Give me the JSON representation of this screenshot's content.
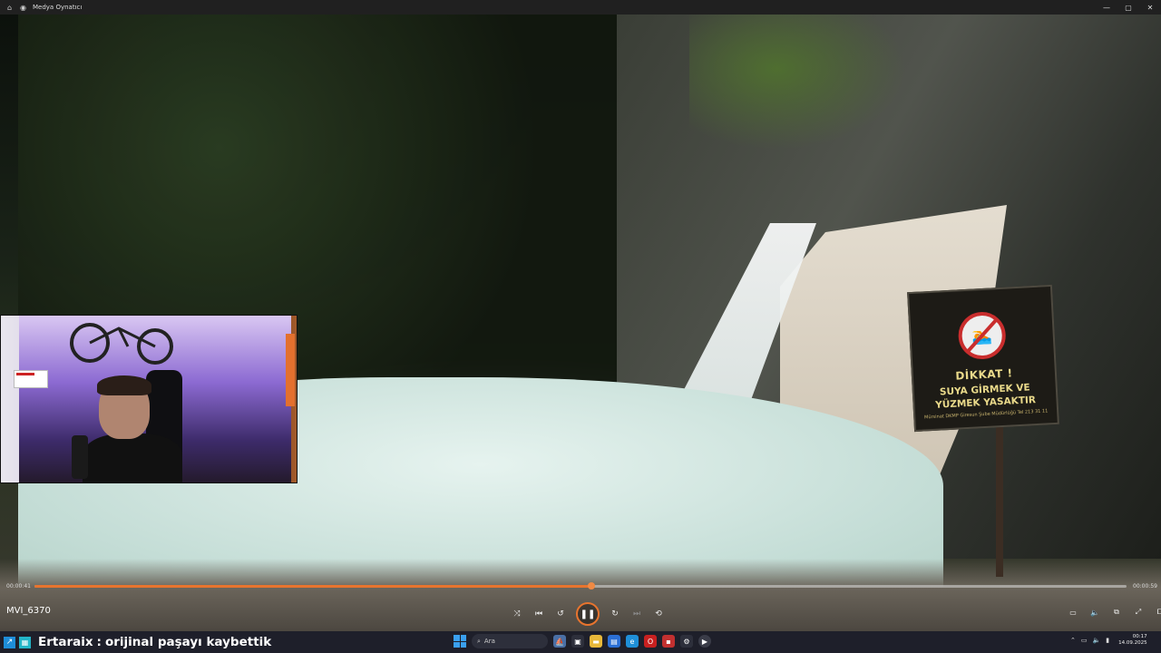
{
  "window": {
    "title": "Medya Oynatıcı",
    "controls": [
      "minimize",
      "maximize",
      "close"
    ]
  },
  "sign": {
    "heading": "DİKKAT !",
    "line1": "SUYA GİRMEK VE",
    "line2": "YÜZMEK YASAKTIR",
    "small": "Mürsinat DKMP Giresun Şube Müdürlüğü Tel 213 31 11"
  },
  "player": {
    "current_time": "00:00:41",
    "total_time": "00:00:59",
    "progress_fraction": 0.51,
    "file_name": "MVI_6370",
    "accent_color": "#e8742e"
  },
  "chat": {
    "user": "Ertaraix",
    "separator": " : ",
    "message": "orijinal paşayı kaybettik"
  },
  "taskbar": {
    "search_placeholder": "Ara",
    "clock_time": "00:17",
    "clock_date": "14.09.2025"
  }
}
